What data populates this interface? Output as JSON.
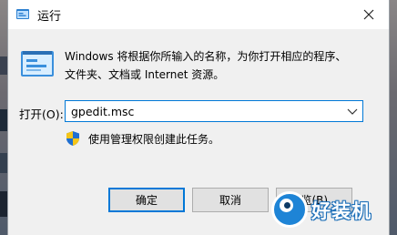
{
  "window": {
    "title": "运行",
    "close_icon": "close-icon",
    "title_icon": "run-icon"
  },
  "description": {
    "line1": "Windows 将根据你所输入的名称，为你打开相应的程序、",
    "line2": "文件夹、文档或 Internet 资源。"
  },
  "open_field": {
    "label": "打开(O):",
    "value": "gpedit.msc"
  },
  "admin_note": {
    "text": "使用管理权限创建此任务。",
    "icon": "uac-shield-icon"
  },
  "buttons": {
    "ok": "确定",
    "cancel": "取消",
    "browse": "浏览(B)..."
  },
  "watermark": {
    "text": "好装机"
  },
  "colors": {
    "accent": "#0078d7",
    "dialog_bg": "#f0f0f0",
    "titlebar_bg": "#ffffff",
    "button_bg": "#e1e1e1",
    "watermark_blue": "#1e84d6"
  }
}
